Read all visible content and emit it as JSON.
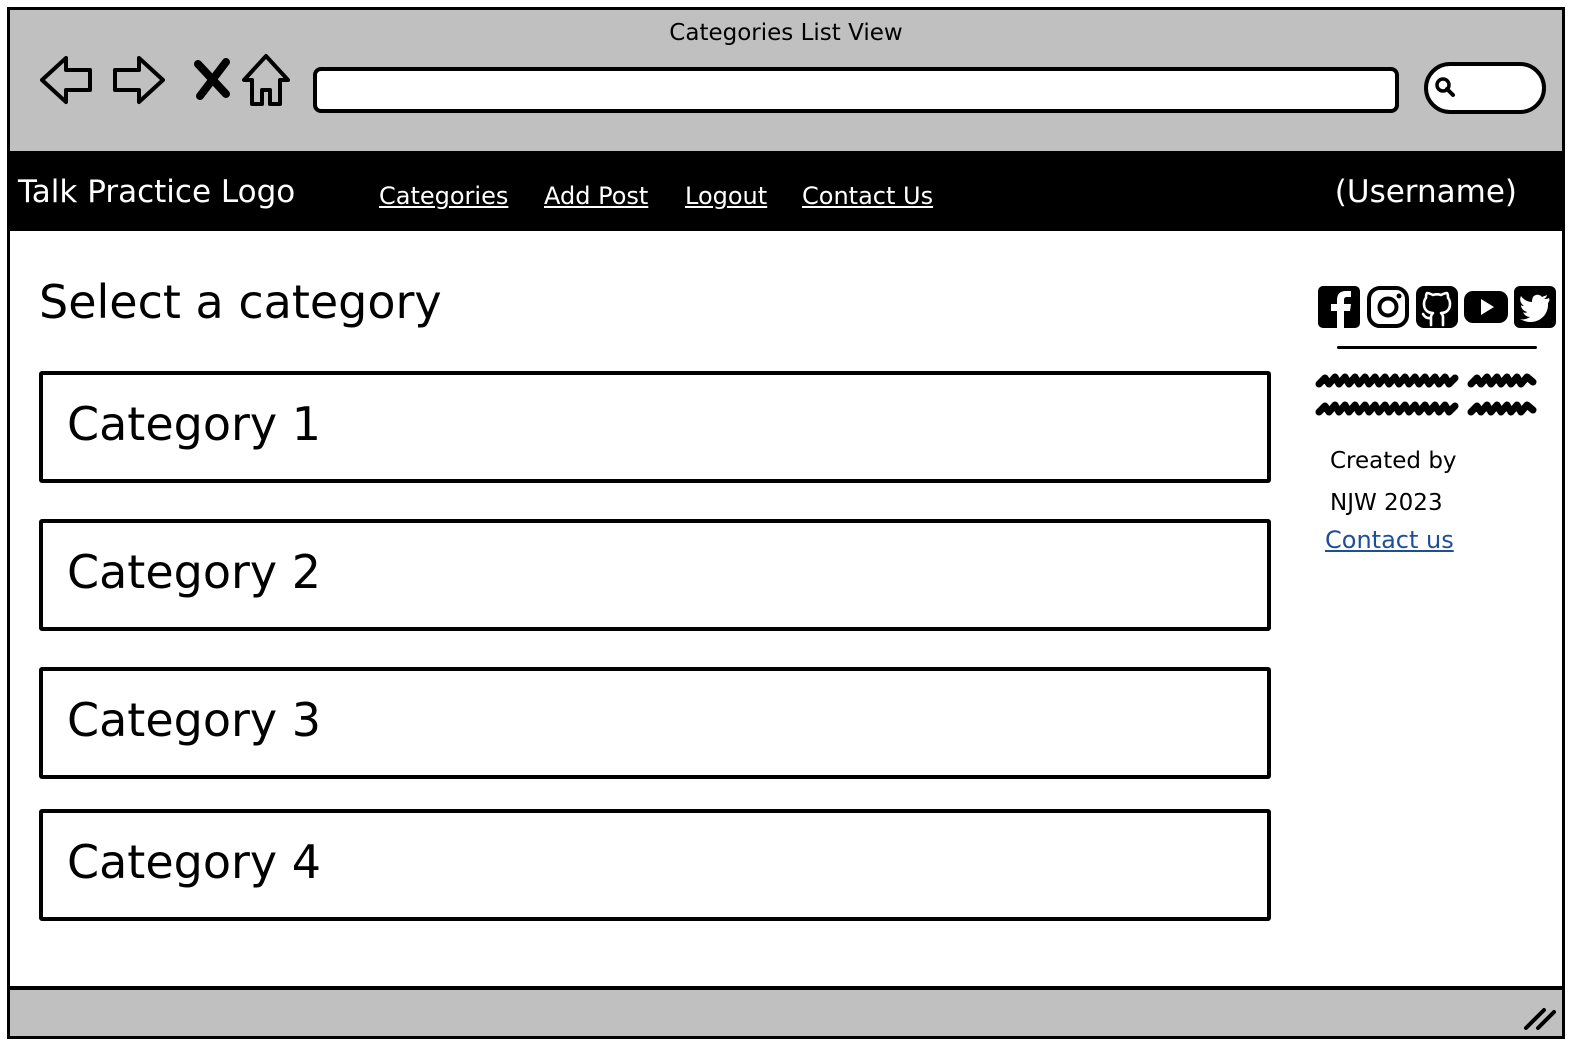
{
  "window": {
    "title": "Categories List View"
  },
  "browser": {
    "back_icon": "back-arrow-icon",
    "forward_icon": "forward-arrow-icon",
    "stop_icon": "close-x-icon",
    "home_icon": "home-icon",
    "address_value": "",
    "search_value": ""
  },
  "navbar": {
    "logo": "Talk Practice Logo",
    "links": [
      "Categories",
      "Add Post",
      "Logout",
      "Contact Us"
    ],
    "username": "(Username)"
  },
  "main": {
    "title": "Select a category",
    "categories": [
      "Category 1",
      "Category 2",
      "Category 3",
      "Category 4"
    ]
  },
  "sidebar": {
    "social_icons": [
      "facebook-icon",
      "instagram-icon",
      "github-icon",
      "youtube-icon",
      "twitter-icon"
    ],
    "credit_line1": "Created by",
    "credit_line2": "NJW 2023",
    "contact_link": "Contact us"
  },
  "colors": {
    "chrome": "#c0c0c0",
    "navbar": "#000000",
    "link": "#1f4e99"
  }
}
